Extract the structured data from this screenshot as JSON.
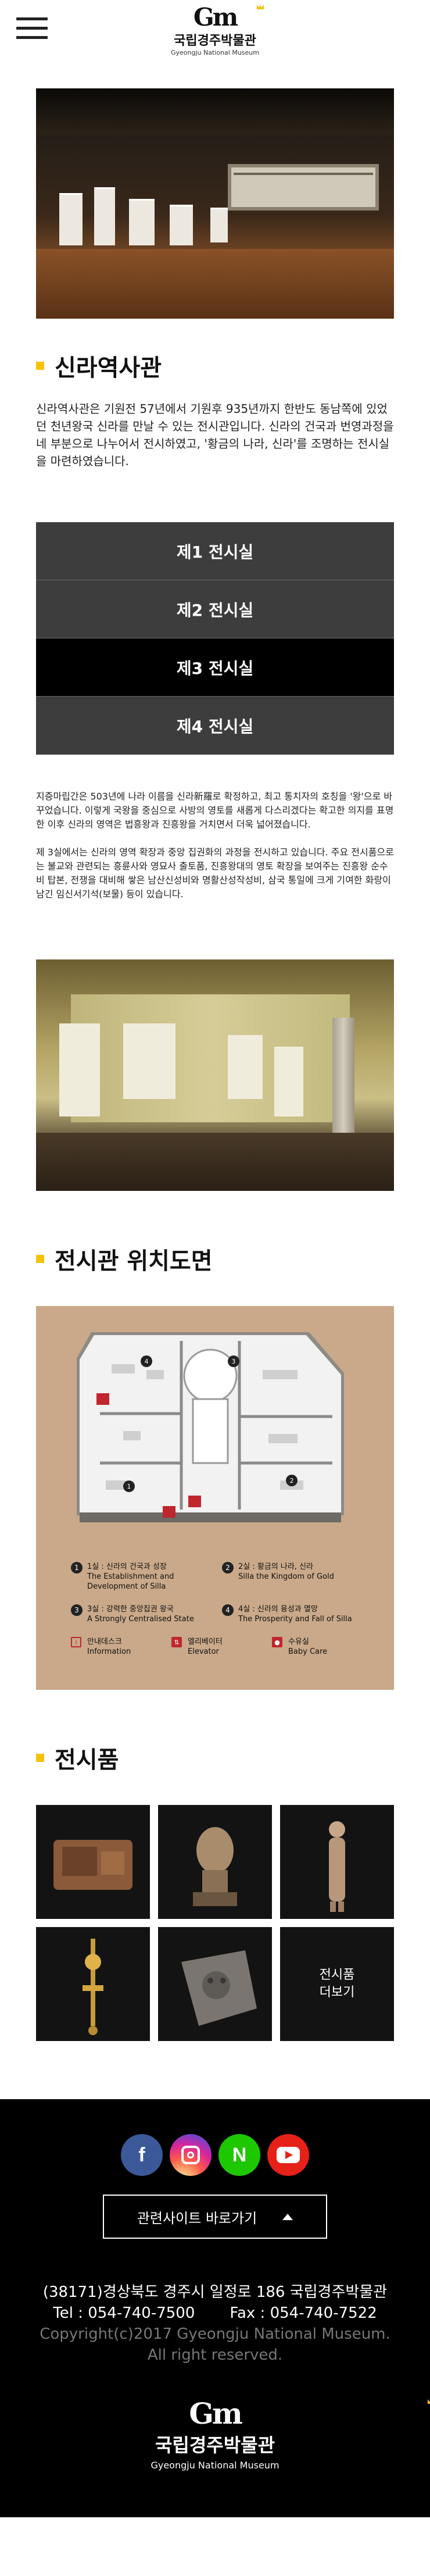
{
  "header": {
    "logo_mark": "Gm",
    "logo_kr": "국립경주박물관",
    "logo_en": "Gyeongju National Museum"
  },
  "section_silla": {
    "title": "신라역사관",
    "intro": "신라역사관은 기원전 57년에서 기원후 935년까지 한반도 동남쪽에 있었던 천년왕국 신라를 만날 수 있는 전시관입니다. 신라의 건국과 번영과정을 네 부분으로 나누어서 전시하였고, '황금의 나라, 신라'를 조명하는 전시실을 마련하였습니다."
  },
  "tabs": [
    {
      "label": "제1 전시실",
      "active": false
    },
    {
      "label": "제2 전시실",
      "active": false
    },
    {
      "label": "제3 전시실",
      "active": true
    },
    {
      "label": "제4 전시실",
      "active": false
    }
  ],
  "tab_content": {
    "paragraph1": "지증마립간은 503년에 나라 이름을 신라新羅로 확정하고, 최고 통치자의 호칭을 '왕'으로 바꾸었습니다. 이렇게 국왕을 중심으로 사방의 영토를 새롭게 다스리겠다는 확고한 의지를 표명한 이후 신라의 영역은 법흥왕과 진흥왕을 거치면서 더욱 넓어졌습니다.",
    "paragraph2": "제 3실에서는 신라의 영역 확장과 중앙 집권화의 과정을 전시하고 있습니다. 주요 전시품으로는 불교와 관련되는 흥륜사와 영묘사 출토품, 진흥왕대의 영토 확장을 보여주는 진흥왕 순수비 탑본, 전쟁을 대비해 쌓은 남산신성비와 명활산성작성비, 삼국 통일에 크게 기여한 화랑이 남긴 임신서기석(보물) 등이 있습니다."
  },
  "section_map": {
    "title": "전시관 위치도면",
    "legend": [
      {
        "num": "1",
        "kr": "1실 : 신라의 건국과 성장",
        "en": "The Establishment and Development of Silla"
      },
      {
        "num": "2",
        "kr": "2실 : 황금의 나라, 신라",
        "en": "Silla the Kingdom of Gold"
      },
      {
        "num": "3",
        "kr": "3실 : 강력한 중앙집권 왕국",
        "en": "A Strongly Centralised State"
      },
      {
        "num": "4",
        "kr": "4실 : 신라의 융성과 멸망",
        "en": "The Prosperity and Fall of Silla"
      }
    ],
    "facilities": [
      {
        "kr": "안내데스크",
        "en": "Information"
      },
      {
        "kr": "엘리베이터",
        "en": "Elevator"
      },
      {
        "kr": "수유실",
        "en": "Baby Care"
      }
    ]
  },
  "section_artifacts": {
    "title": "전시품",
    "more_line1": "전시품",
    "more_line2": "더보기"
  },
  "footer": {
    "sns": [
      "facebook",
      "instagram",
      "naver",
      "youtube"
    ],
    "related_label": "관련사이트 바로가기",
    "address": "(38171)경상북도 경주시 일정로 186 국립경주박물관",
    "tel": "Tel : 054-740-7500",
    "fax": "Fax : 054-740-7522",
    "copyright1": "Copyright(c)2017 Gyeongju National Museum.",
    "copyright2": "All right reserved.",
    "logo_mark": "Gm",
    "logo_kr": "국립경주박물관",
    "logo_en": "Gyeongju National Museum"
  },
  "colors": {
    "accent": "#f5c200",
    "tab_bg": "#3d3d3d",
    "tab_active": "#000000",
    "map_bg": "#c9a989",
    "footer_bg": "#000000"
  }
}
